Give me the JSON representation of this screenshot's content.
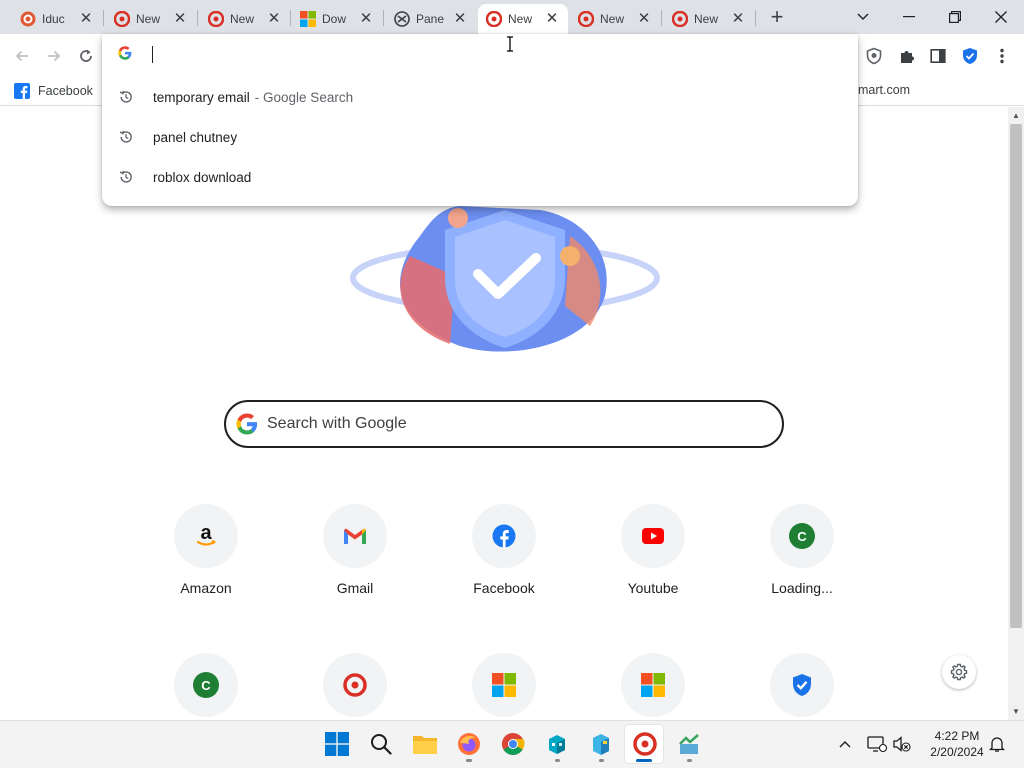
{
  "tabs": [
    {
      "label": "Iduc",
      "icon": "duckduckgo-icon"
    },
    {
      "label": "New",
      "icon": "custom-browser-icon"
    },
    {
      "label": "New",
      "icon": "custom-browser-icon"
    },
    {
      "label": "Dow",
      "icon": "microsoft-icon"
    },
    {
      "label": "Pane",
      "icon": "panel-icon"
    },
    {
      "label": "New",
      "icon": "custom-browser-icon",
      "active": true
    },
    {
      "label": "New",
      "icon": "custom-browser-icon"
    },
    {
      "label": "New",
      "icon": "custom-browser-icon"
    }
  ],
  "omnibox": {
    "value": "",
    "suggestions": [
      {
        "text": "temporary email",
        "suffix": "- Google Search",
        "icon": "history-icon"
      },
      {
        "text": "panel chutney",
        "suffix": "",
        "icon": "history-icon"
      },
      {
        "text": "roblox download",
        "suffix": "",
        "icon": "history-icon"
      }
    ]
  },
  "bookmarks": {
    "facebook": "Facebook",
    "right_partial": "mart.com"
  },
  "search": {
    "placeholder": "Search with Google"
  },
  "shortcuts": [
    {
      "label": "Amazon",
      "icon": "amazon-icon"
    },
    {
      "label": "Gmail",
      "icon": "gmail-icon"
    },
    {
      "label": "Facebook",
      "icon": "facebook-icon"
    },
    {
      "label": "Youtube",
      "icon": "youtube-icon"
    },
    {
      "label": "Loading...",
      "icon": "letter-c-icon",
      "letter": "C"
    },
    {
      "label": "",
      "icon": "letter-c-icon",
      "letter": "C"
    },
    {
      "label": "",
      "icon": "custom-browser-icon"
    },
    {
      "label": "",
      "icon": "microsoft-icon"
    },
    {
      "label": "",
      "icon": "microsoft-icon"
    },
    {
      "label": "",
      "icon": "shield-check-icon"
    }
  ],
  "taskbar": {
    "time": "4:22 PM",
    "date": "2/20/2024"
  },
  "colors": {
    "accent": "#1a73e8",
    "tabstrip": "#dee1e6",
    "taskbar": "#f3f3f3"
  }
}
